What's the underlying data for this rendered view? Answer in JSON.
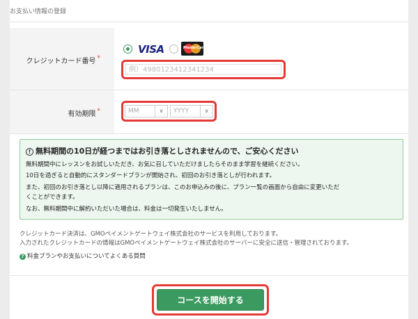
{
  "section_title": "お支払い情報の登録",
  "card_number": {
    "label": "クレジットカード番号",
    "required_mark": "*",
    "brands": [
      {
        "name": "VISA",
        "selected": true
      },
      {
        "name": "MasterCard",
        "selected": false
      }
    ],
    "placeholder": "例）4980123412341234"
  },
  "expiry": {
    "label": "有効期限",
    "required_mark": "*",
    "month_value": "MM",
    "year_value": "YYYY",
    "chevron": "∨"
  },
  "notice": {
    "icon": "!",
    "title": "無料期間の10日が経つまではお引き落としされませんので、ご安心ください",
    "lines": [
      "無料期間中にレッスンをお試しいただき、お気に召していただけましたらそのまま学習を継続ください。",
      "10日を過ぎると自動的にスタンダードプランが開始され、初回のお引き落としが行われます。",
      "また、初回のお引き落とし以降に適用されるプランは、このお申込みの後に、プラン一覧の画面から自由に変更いただ",
      "くことができます。",
      "なお、無料期間中に解約いただいた場合は、料金は一切発生いたしません。"
    ]
  },
  "info": [
    "クレジットカード決済は、GMOペイメントゲートウェイ株式会社のサービスを利用しております。",
    "入力されたクレジットカードの情報はGMOペイメントゲートウェイ株式会社のサーバーに安全に送信・管理されております。"
  ],
  "faq": {
    "icon": "?",
    "label": "料金プランやお支払いについてよくある質問"
  },
  "start_button": "コースを開始する",
  "colors": {
    "accent": "#3a9a5f",
    "highlight": "#e53935"
  }
}
